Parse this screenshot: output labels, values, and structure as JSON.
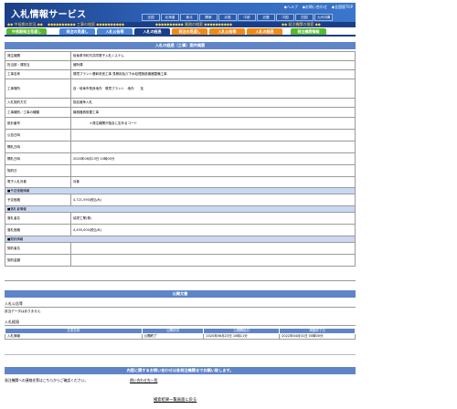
{
  "header": {
    "site_title": "入札情報サービス",
    "top_links": [
      "◆ヘルプ",
      "◆お問い合わせ",
      "◆全国版TOP"
    ],
    "regions": [
      "全国",
      "北海道",
      "東北",
      "関東",
      "北陸",
      "中部",
      "近畿",
      "中国",
      "四国",
      "九州沖縄"
    ],
    "subbar_groups": [
      "◆◆ 中長期の状況 ◆◆",
      "◆◆◆◆◆◆◆◆◆◆ 工事の検索 ◆◆◆◆◆◆◆◆◆◆",
      "◆◆◆◆◆◆◆◆◆◆ 業務の検索 ◆◆◆◆◆◆◆◆◆◆",
      "◆◆ 発注機関の検索 ◆◆"
    ]
  },
  "tabs": [
    "中長期発注見通し",
    "発注の見通し",
    "入札公告等",
    "入札の経過",
    "発注の見通し",
    "入札公告等",
    "入札の経過",
    "発注機関情報"
  ],
  "main": {
    "section_title": "入札の経過（工事）案件概要",
    "rows": [
      {
        "label": "発注機関",
        "value": "岐阜県市町村共同電子入札システム"
      },
      {
        "label": "担当部・課担当",
        "value": "管財課"
      },
      {
        "label": "工事名称",
        "value": "環境プラント基幹改良工事 見積用及び下水処理施設機器整備工事"
      },
      {
        "label": "工事場所",
        "value": "自・岐阜市長良地内　環境プラント　地内　　至"
      },
      {
        "label": "入札契約方式",
        "value": "指名競争入札"
      },
      {
        "label": "工事種別／工事の種類",
        "value": "機械器具設置工事"
      },
      {
        "label": "設計番号",
        "value": "　　　　　＊発注機関が独自に定めるコード"
      },
      {
        "label": "公告日時",
        "value": ""
      },
      {
        "label": "開札日時",
        "value": ""
      },
      {
        "label": "開札日時",
        "value": "2020年06月23日 10時00分"
      },
      {
        "label": "契約日",
        "value": ""
      },
      {
        "label": "電子入札対象",
        "value": "対象"
      }
    ],
    "sub_estimate": "■予定価格情報",
    "estimate_label": "予定価格",
    "estimate_value": "4,721,590(税込み)",
    "sub_winner": "■落札者情報",
    "winner_name_label": "落札者名",
    "winner_name_value": "協栄工業(株)",
    "winner_price_label": "落札価格",
    "winner_price_value": "4,455,000(税込み)",
    "sub_contract": "■契約情報",
    "contract_name_label": "契約者名",
    "contract_amount_label": "契約金額"
  },
  "public_docs": {
    "title": "公開文書",
    "notice_label": "入札公告等",
    "notice_empty": "該当データはありません",
    "history_label": "入札経過",
    "columns": [
      "文書名称",
      "公開状況",
      "公開開始日",
      "掲載終了日"
    ],
    "rows": [
      [
        "入札情報",
        "公開終了",
        "2020年06月23日 10時11分",
        "2022年04月01日 00時00分"
      ]
    ]
  },
  "contact": {
    "title": "内容に関するお問い合わせは各発注機関までお願い致します。",
    "text": "発注機関への連絡先等はこちらからご確認ください。",
    "link": "問い合わせ先一覧"
  },
  "back_link": "検索結果一覧画面に戻る"
}
